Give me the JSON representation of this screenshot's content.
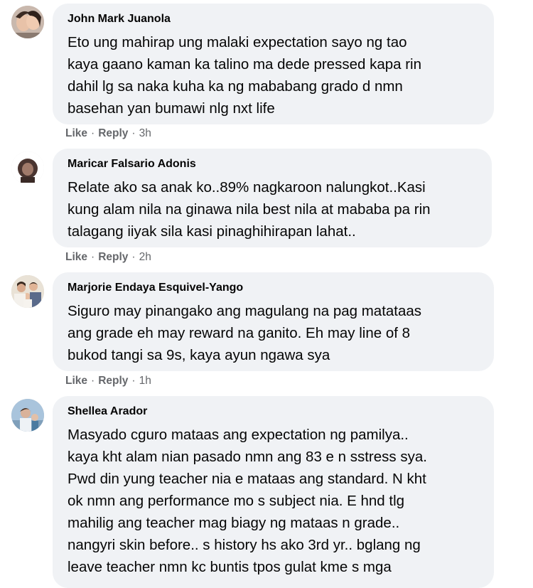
{
  "comments": [
    {
      "author": "John Mark Juanola",
      "lines": [
        "Eto ung mahirap ung malaki expectation sayo ng tao",
        "kaya gaano kaman ka talino ma dede pressed kapa rin",
        "dahil lg sa naka kuha ka ng mababang grado d nmn",
        "basehan yan bumawi nlg nxt life"
      ],
      "like": "Like",
      "reply": "Reply",
      "time": "3h"
    },
    {
      "author": "Maricar Falsario Adonis",
      "lines": [
        "Relate ako sa anak ko..89% nagkaroon nalungkot..Kasi",
        "kung alam nila na ginawa nila best nila at mababa pa rin",
        "talagang iiyak sila kasi pinaghihirapan lahat.."
      ],
      "like": "Like",
      "reply": "Reply",
      "time": "2h"
    },
    {
      "author": "Marjorie Endaya Esquivel-Yango",
      "lines": [
        "Siguro may pinangako ang magulang na pag matataas",
        "ang grade eh may reward na ganito. Eh may line of 8",
        "bukod tangi sa 9s, kaya ayun ngawa sya"
      ],
      "like": "Like",
      "reply": "Reply",
      "time": "1h"
    },
    {
      "author": "Shellea Arador",
      "lines": [
        "Masyado cguro mataas ang expectation ng pamilya..",
        "kaya kht alam nian pasado nmn ang 83 e n sstress sya.",
        "Pwd din yung teacher nia e mataas ang standard. N kht",
        "ok nmn ang performance mo s subject nia. E hnd tlg",
        "mahilig ang teacher mag biagy ng mataas n grade..",
        "nangyri skin before.. s history hs ako 3rd yr.. bglang ng",
        "leave teacher nmn kc buntis tpos gulat kme s mga"
      ]
    }
  ],
  "separator": "·",
  "colors": {
    "bubble": "#f0f2f5",
    "text": "#050505",
    "meta": "#65676b"
  }
}
